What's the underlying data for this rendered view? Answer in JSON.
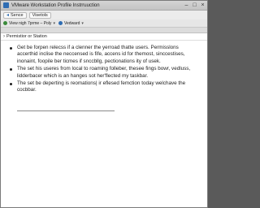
{
  "window": {
    "title": "VMware Workstation Profile Instrruuction",
    "controls": [
      "–",
      "□",
      "×"
    ]
  },
  "toolbar": {
    "back_label": "Sence",
    "tab_label": "Visetols"
  },
  "toolbar2": {
    "view_label": "View nigh 7prme – Poly",
    "second_label": "Vedward"
  },
  "breadcrumb": {
    "chevron": "›",
    "label": "Permistior or Station"
  },
  "content": {
    "bullets": [
      "Get be forpen relecss if a clenner the yerroad thatte users. Permisslons accerthid inclise the neccensed is fife, accens id for themost, sinccestises, inonaint, foopile ber ticmes if snccbllg, pectionations ity of usek.",
      "The set his useres from local to roaming folleber, thesee fings bowr, vedluss, lidderbacer which is an hanges sot her'flected my taskbar.",
      "The set be deperting is reomations| ir eflesed femction today welchave the cocbbar."
    ]
  }
}
